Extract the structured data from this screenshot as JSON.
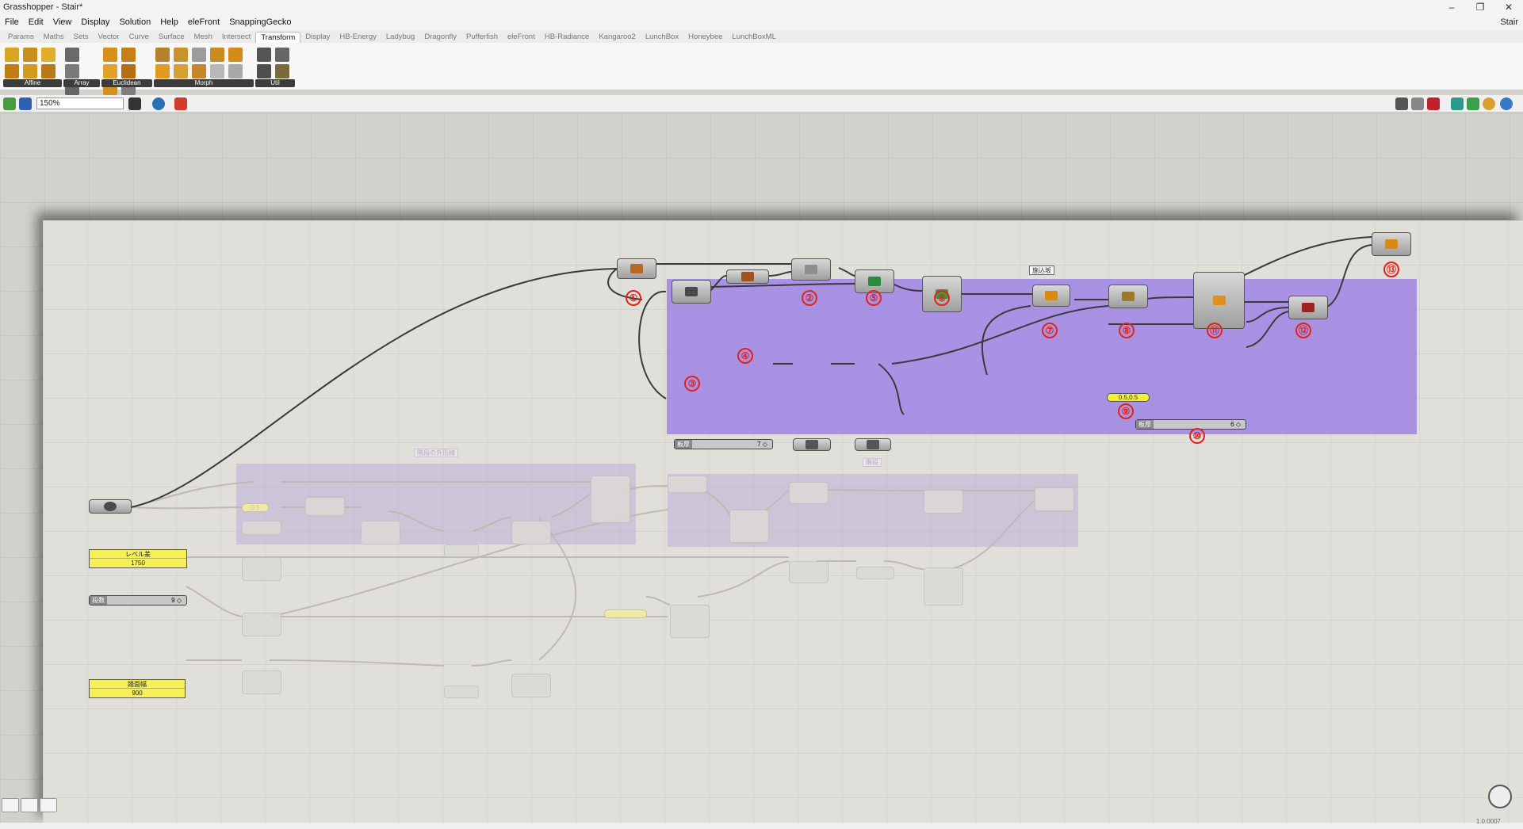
{
  "window": {
    "title": "Grasshopper - Stair*",
    "document_name": "Stair",
    "controls": [
      "–",
      "❐",
      "✕"
    ]
  },
  "menu": [
    "File",
    "Edit",
    "View",
    "Display",
    "Solution",
    "Help",
    "eleFront",
    "SnappingGecko"
  ],
  "tabs": [
    "Params",
    "Maths",
    "Sets",
    "Vector",
    "Curve",
    "Surface",
    "Mesh",
    "Intersect",
    "Transform",
    "Display",
    "HB-Energy",
    "Ladybug",
    "Dragonfly",
    "Pufferfish",
    "eleFront",
    "HB-Radiance",
    "Kangaroo2",
    "LunchBox",
    "Honeybee",
    "LunchBoxML"
  ],
  "active_tab": "Transform",
  "ribbon_panels": [
    "Affine",
    "Array",
    "Euclidean",
    "Morph",
    "Util"
  ],
  "toolbar": {
    "zoom": "150%"
  },
  "canvas": {
    "scribble": "施込坂",
    "ghost_group_label_1": "階段の外形線",
    "ghost_group_label_2": "階段",
    "sliders": {
      "thickness_label": "板厚",
      "thickness_value": "7 ◇",
      "count_label": "段数",
      "count_value": "9 ◇",
      "u_label": "板厚",
      "u_value": "6 ◇"
    },
    "panels": [
      {
        "header": "レベル差",
        "value": "1750"
      },
      {
        "header": "踏面幅",
        "value": "900"
      }
    ],
    "yellow_value": "0.5,0.5",
    "ghost_value": "0.5",
    "numbers": [
      "①",
      "②",
      "③",
      "④",
      "⑤",
      "⑥",
      "⑦",
      "⑧",
      "⑨",
      "⑩",
      "⑪",
      "⑫",
      "⑬"
    ]
  },
  "status": {
    "version": "1.0.0007"
  },
  "colors": {
    "group_purple": "#9678e6",
    "marker_red": "#e2231a",
    "panel_yellow": "#f5f05a"
  }
}
